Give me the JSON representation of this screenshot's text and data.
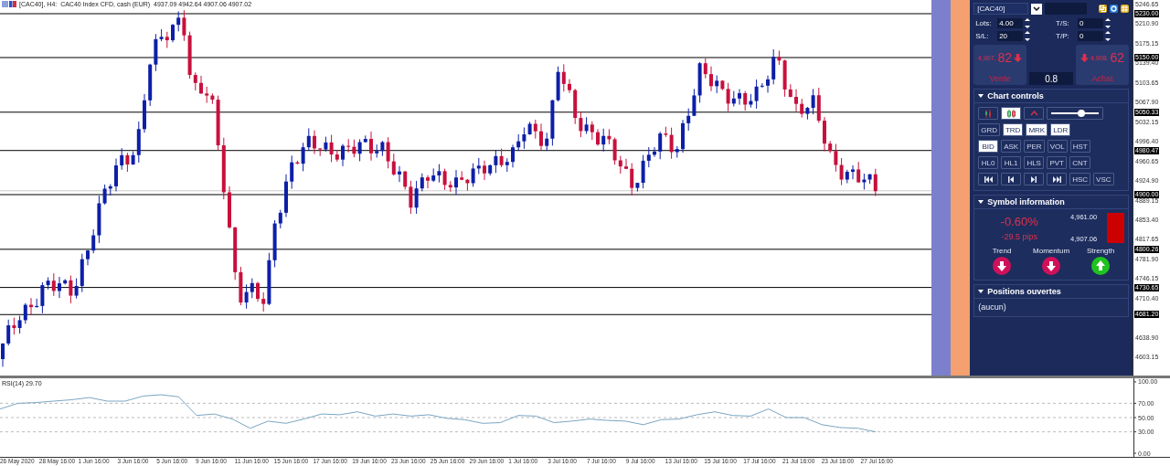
{
  "chart_header": {
    "text": "[CAC40], H4:  CAC40 Index CFD, cash (EUR)  4937.09 4942.64 4907.06 4907.02"
  },
  "price_axis": [
    {
      "label": "5246.65",
      "highlighted": false
    },
    {
      "label": "5230.00",
      "highlighted": true
    },
    {
      "label": "5210.90",
      "highlighted": false
    },
    {
      "label": "5175.15",
      "highlighted": false
    },
    {
      "label": "5150.00",
      "highlighted": true
    },
    {
      "label": "5139.40",
      "highlighted": false
    },
    {
      "label": "5103.65",
      "highlighted": false
    },
    {
      "label": "5067.90",
      "highlighted": false
    },
    {
      "label": "5050.33",
      "highlighted": true
    },
    {
      "label": "5032.15",
      "highlighted": false
    },
    {
      "label": "4996.40",
      "highlighted": false
    },
    {
      "label": "4980.47",
      "highlighted": true
    },
    {
      "label": "4960.65",
      "highlighted": false
    },
    {
      "label": "4924.90",
      "highlighted": false
    },
    {
      "label": "4900.00",
      "highlighted": true
    },
    {
      "label": "4889.15",
      "highlighted": false
    },
    {
      "label": "4853.40",
      "highlighted": false
    },
    {
      "label": "4817.65",
      "highlighted": false
    },
    {
      "label": "4800.26",
      "highlighted": true
    },
    {
      "label": "4781.90",
      "highlighted": false
    },
    {
      "label": "4746.15",
      "highlighted": false
    },
    {
      "label": "4730.65",
      "highlighted": true
    },
    {
      "label": "4710.40",
      "highlighted": false
    },
    {
      "label": "4681.20",
      "highlighted": true
    },
    {
      "label": "4638.90",
      "highlighted": false
    },
    {
      "label": "4603.15",
      "highlighted": false
    }
  ],
  "panel": {
    "symbol": "[CAC40]",
    "fields": [
      {
        "label": "Lots:",
        "value": "4.00"
      },
      {
        "label": "T/S:",
        "value": "0"
      },
      {
        "label": "S/L:",
        "value": "20"
      },
      {
        "label": "T/P:",
        "value": "0"
      }
    ],
    "sell": {
      "price": "4,907.",
      "pips": "82",
      "label": "Vente"
    },
    "buy": {
      "price": "4,908.",
      "pips": "62",
      "label": "Achat"
    },
    "spread": "0.8",
    "chart_controls": {
      "title": "Chart controls",
      "slider": {
        "level": 0.62
      },
      "icon_buttons": [
        {
          "kind": "bars",
          "selected": false
        },
        {
          "kind": "candles",
          "selected": true
        },
        {
          "kind": "caret",
          "selected": false
        }
      ],
      "rows": [
        [
          {
            "label": "GRD",
            "selected": false
          },
          {
            "label": "TRD",
            "selected": true
          },
          {
            "label": "MRK",
            "selected": true
          },
          {
            "label": "LDR",
            "selected": true
          }
        ],
        [
          {
            "label": "BID",
            "selected": true
          },
          {
            "label": "ASK",
            "selected": false
          },
          {
            "label": "PER",
            "selected": false
          },
          {
            "label": "VOL",
            "selected": false
          },
          {
            "label": "HST",
            "selected": false
          }
        ],
        [
          {
            "label": "HL0",
            "selected": false
          },
          {
            "label": "HL1",
            "selected": false
          },
          {
            "label": "HLS",
            "selected": false
          },
          {
            "label": "PVT",
            "selected": false
          },
          {
            "label": "CNT",
            "selected": false
          }
        ]
      ],
      "nav_buttons": [
        {
          "kind": "first"
        },
        {
          "kind": "prev"
        },
        {
          "kind": "next"
        },
        {
          "kind": "last"
        },
        {
          "kind": "text",
          "label": "HSC"
        },
        {
          "kind": "text",
          "label": "VSC"
        }
      ]
    },
    "symbol_information": {
      "title": "Symbol information",
      "change": "-0.60%",
      "pips": "-29.5 pips",
      "high": "4,961.00",
      "low": "4,907.06",
      "indicators": [
        {
          "label": "Trend",
          "kind": "down"
        },
        {
          "label": "Momentum",
          "kind": "down"
        },
        {
          "label": "Strength",
          "kind": "up"
        }
      ]
    },
    "positions": {
      "title": "Positions ouvertes",
      "empty_text": "(aucun)"
    }
  },
  "rsi": {
    "chart_data": {
      "type": "line",
      "title": "RSI(14) 29.70",
      "grid": true,
      "ylim": [
        -5,
        105
      ],
      "yticks": [
        {
          "value": 100,
          "label": "100.00"
        },
        {
          "value": 70,
          "label": "70.00"
        },
        {
          "value": 50,
          "label": "50.00"
        },
        {
          "value": 30,
          "label": "30.00"
        },
        {
          "value": 0,
          "label": "0.00"
        }
      ],
      "series": [
        {
          "color": "#7aa6c2",
          "values": [
            62,
            70,
            71,
            73,
            75,
            78,
            73,
            73,
            80,
            82,
            79,
            53,
            55,
            48,
            35,
            45,
            42,
            48,
            55,
            54,
            58,
            52,
            55,
            52,
            54,
            49,
            47,
            42,
            43,
            53,
            52,
            43,
            45,
            48,
            46,
            45,
            40,
            47,
            48,
            54,
            58,
            53,
            52,
            62,
            50,
            50,
            40,
            36,
            35,
            30
          ]
        }
      ]
    }
  },
  "time_axis": [
    "26 May 2020",
    "28 May 16:00",
    "1 Jun 16:00",
    "3 Jun 16:00",
    "5 Jun 16:00",
    "9 Jun 16:00",
    "11 Jun 16:00",
    "15 Jun 16:00",
    "17 Jun 16:00",
    "19 Jun 16:00",
    "23 Jun 16:00",
    "25 Jun 16:00",
    "29 Jun 16:00",
    "1 Jul 16:00",
    "3 Jul 16:00",
    "7 Jul 16:00",
    "9 Jul 16:00",
    "13 Jul 16:00",
    "15 Jul 16:00",
    "17 Jul 16:00",
    "21 Jul 16:00",
    "23 Jul 16:00",
    "27 Jul 16:00"
  ]
}
